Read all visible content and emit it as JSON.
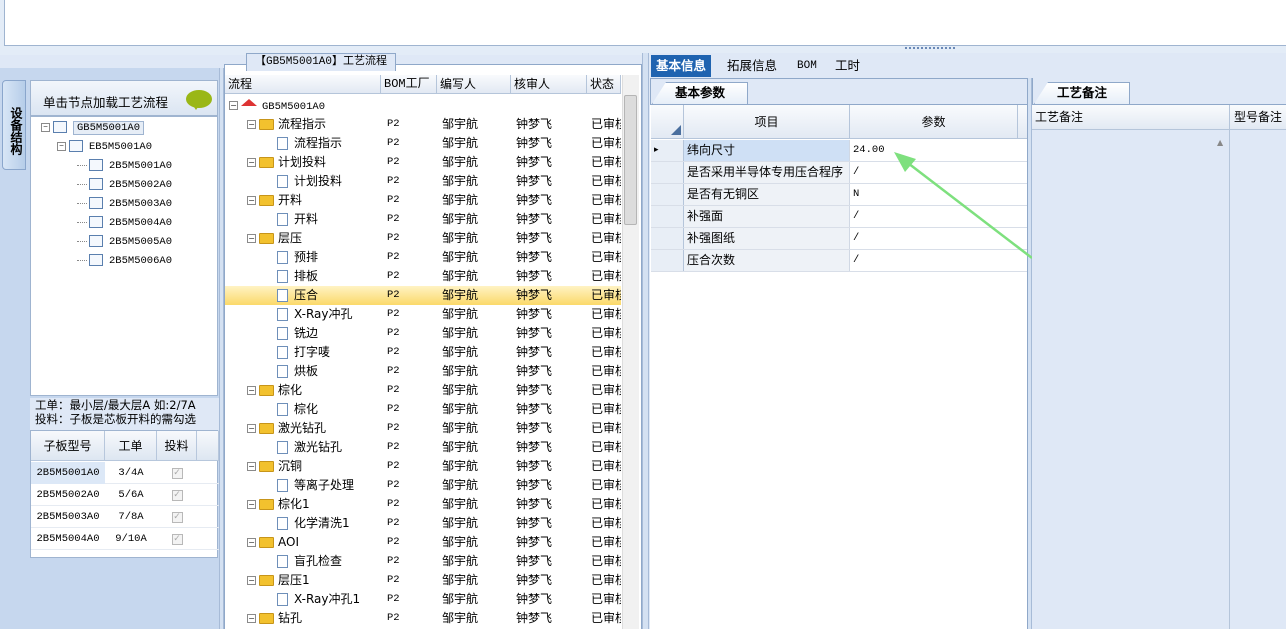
{
  "left_panel": {
    "vertical_tab": "设备结构",
    "header": "单击节点加载工艺流程",
    "tree": [
      {
        "label": "GB5M5001A0",
        "level": 0
      },
      {
        "label": "EB5M5001A0",
        "level": 1
      },
      {
        "label": "2B5M5001A0",
        "level": 2
      },
      {
        "label": "2B5M5002A0",
        "level": 2
      },
      {
        "label": "2B5M5003A0",
        "level": 2
      },
      {
        "label": "2B5M5004A0",
        "level": 2
      },
      {
        "label": "2B5M5005A0",
        "level": 2
      },
      {
        "label": "2B5M5006A0",
        "level": 2
      }
    ],
    "info_line1": "工单：最小层/最大层A 如:2/7A",
    "info_line2": "投料：子板是芯板开料的需勾选",
    "grid": {
      "headers": [
        "子板型号",
        "工单",
        "投料"
      ],
      "rows": [
        {
          "model": "2B5M5001A0",
          "order": "3/4A",
          "feed": "✓"
        },
        {
          "model": "2B5M5002A0",
          "order": "5/6A",
          "feed": "✓"
        },
        {
          "model": "2B5M5003A0",
          "order": "7/8A",
          "feed": "✓"
        },
        {
          "model": "2B5M5004A0",
          "order": "9/10A",
          "feed": "✓"
        }
      ]
    }
  },
  "middle_panel": {
    "title": "【GB5M5001A0】工艺流程",
    "headers": [
      "流程",
      "BOM工厂",
      "编写人",
      "核审人",
      "状态"
    ],
    "root": "GB5M5001A0",
    "rows": [
      {
        "name": "流程指示",
        "type": "folder",
        "factory": "P2",
        "author": "邹宇航",
        "reviewer": "钟梦飞",
        "status": "已审核"
      },
      {
        "name": "流程指示",
        "type": "doc",
        "factory": "P2",
        "author": "邹宇航",
        "reviewer": "钟梦飞",
        "status": "已审核"
      },
      {
        "name": "计划投料",
        "type": "folder",
        "factory": "P2",
        "author": "邹宇航",
        "reviewer": "钟梦飞",
        "status": "已审核"
      },
      {
        "name": "计划投料",
        "type": "doc",
        "factory": "P2",
        "author": "邹宇航",
        "reviewer": "钟梦飞",
        "status": "已审核"
      },
      {
        "name": "开料",
        "type": "folder",
        "factory": "P2",
        "author": "邹宇航",
        "reviewer": "钟梦飞",
        "status": "已审核"
      },
      {
        "name": "开料",
        "type": "doc",
        "factory": "P2",
        "author": "邹宇航",
        "reviewer": "钟梦飞",
        "status": "已审核"
      },
      {
        "name": "层压",
        "type": "folder",
        "factory": "P2",
        "author": "邹宇航",
        "reviewer": "钟梦飞",
        "status": "已审核"
      },
      {
        "name": "预排",
        "type": "doc",
        "factory": "P2",
        "author": "邹宇航",
        "reviewer": "钟梦飞",
        "status": "已审核"
      },
      {
        "name": "排板",
        "type": "doc",
        "factory": "P2",
        "author": "邹宇航",
        "reviewer": "钟梦飞",
        "status": "已审核"
      },
      {
        "name": "压合",
        "type": "doc",
        "factory": "P2",
        "author": "邹宇航",
        "reviewer": "钟梦飞",
        "status": "已审核",
        "selected": true
      },
      {
        "name": "X-Ray冲孔",
        "type": "doc",
        "factory": "P2",
        "author": "邹宇航",
        "reviewer": "钟梦飞",
        "status": "已审核"
      },
      {
        "name": "铣边",
        "type": "doc",
        "factory": "P2",
        "author": "邹宇航",
        "reviewer": "钟梦飞",
        "status": "已审核"
      },
      {
        "name": "打字唛",
        "type": "doc",
        "factory": "P2",
        "author": "邹宇航",
        "reviewer": "钟梦飞",
        "status": "已审核"
      },
      {
        "name": "烘板",
        "type": "doc",
        "factory": "P2",
        "author": "邹宇航",
        "reviewer": "钟梦飞",
        "status": "已审核"
      },
      {
        "name": "棕化",
        "type": "folder",
        "factory": "P2",
        "author": "邹宇航",
        "reviewer": "钟梦飞",
        "status": "已审核"
      },
      {
        "name": "棕化",
        "type": "doc",
        "factory": "P2",
        "author": "邹宇航",
        "reviewer": "钟梦飞",
        "status": "已审核"
      },
      {
        "name": "激光钻孔",
        "type": "folder",
        "factory": "P2",
        "author": "邹宇航",
        "reviewer": "钟梦飞",
        "status": "已审核"
      },
      {
        "name": "激光钻孔",
        "type": "doc",
        "factory": "P2",
        "author": "邹宇航",
        "reviewer": "钟梦飞",
        "status": "已审核"
      },
      {
        "name": "沉铜",
        "type": "folder",
        "factory": "P2",
        "author": "邹宇航",
        "reviewer": "钟梦飞",
        "status": "已审核"
      },
      {
        "name": "等离子处理",
        "type": "doc",
        "factory": "P2",
        "author": "邹宇航",
        "reviewer": "钟梦飞",
        "status": "已审核"
      },
      {
        "name": "棕化1",
        "type": "folder",
        "factory": "P2",
        "author": "邹宇航",
        "reviewer": "钟梦飞",
        "status": "已审核"
      },
      {
        "name": "化学清洗1",
        "type": "doc",
        "factory": "P2",
        "author": "邹宇航",
        "reviewer": "钟梦飞",
        "status": "已审核"
      },
      {
        "name": "AOI",
        "type": "folder",
        "factory": "P2",
        "author": "邹宇航",
        "reviewer": "钟梦飞",
        "status": "已审核"
      },
      {
        "name": "盲孔检查",
        "type": "doc",
        "factory": "P2",
        "author": "邹宇航",
        "reviewer": "钟梦飞",
        "status": "已审核"
      },
      {
        "name": "层压1",
        "type": "folder",
        "factory": "P2",
        "author": "邹宇航",
        "reviewer": "钟梦飞",
        "status": "已审核"
      },
      {
        "name": "X-Ray冲孔1",
        "type": "doc",
        "factory": "P2",
        "author": "邹宇航",
        "reviewer": "钟梦飞",
        "status": "已审核"
      },
      {
        "name": "钻孔",
        "type": "folder",
        "factory": "P2",
        "author": "邹宇航",
        "reviewer": "钟梦飞",
        "status": "已审核"
      }
    ]
  },
  "tabs": [
    "基本信息",
    "拓展信息",
    "BOM",
    "工时"
  ],
  "basic_params": {
    "tab": "基本参数",
    "headers": [
      "项目",
      "参数"
    ],
    "rows": [
      {
        "item": "纬向尺寸",
        "value": "24.00"
      },
      {
        "item": "是否采用半导体专用压合程序",
        "value": "/"
      },
      {
        "item": "是否有无铜区",
        "value": "N"
      },
      {
        "item": "补强面",
        "value": "/"
      },
      {
        "item": "补强图纸",
        "value": "/"
      },
      {
        "item": "压合次数",
        "value": "/"
      }
    ]
  },
  "notes": {
    "tab": "工艺备注",
    "headers": [
      "工艺备注",
      "型号备注"
    ]
  },
  "colors": {
    "accent": "#1f63b0",
    "selection": "#fbd96a",
    "arrow": "#7ee07e"
  }
}
